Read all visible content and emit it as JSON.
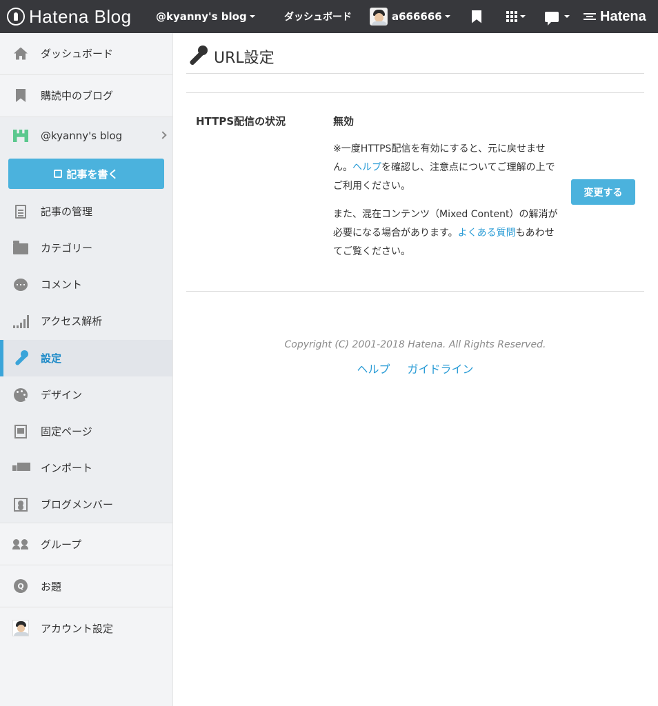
{
  "topbar": {
    "logo_text": "Hatena Blog",
    "blog_name": "@kyanny's blog",
    "dashboard_label": "ダッシュボード",
    "username": "a666666",
    "hatena_label": "Hatena"
  },
  "sidebar": {
    "items": [
      {
        "label": "ダッシュボード"
      },
      {
        "label": "購読中のブログ"
      },
      {
        "label": "@kyanny's blog"
      },
      {
        "label": "記事の管理"
      },
      {
        "label": "カテゴリー"
      },
      {
        "label": "コメント"
      },
      {
        "label": "アクセス解析"
      },
      {
        "label": "設定"
      },
      {
        "label": "デザイン"
      },
      {
        "label": "固定ページ"
      },
      {
        "label": "インポート"
      },
      {
        "label": "ブログメンバー"
      },
      {
        "label": "グループ"
      },
      {
        "label": "お題"
      },
      {
        "label": "アカウント設定"
      }
    ],
    "write_button": "記事を書く",
    "active_index": 7
  },
  "main": {
    "title": "URL設定",
    "https_label": "HTTPS配信の状況",
    "https_value": "無効",
    "desc1": {
      "part1": "※一度HTTPS配信を有効にすると、元に戻せません。",
      "link": "ヘルプ",
      "part2": "を確認し、注意点についてご理解の上でご利用ください。"
    },
    "desc2": {
      "part1": "また、混在コンテンツ（Mixed Content）の解消が必要になる場合があります。",
      "link": "よくある質問",
      "part2": "もあわせてご覧ください。"
    },
    "change_button": "変更する"
  },
  "footer": {
    "copyright": "Copyright (C) 2001-2018 Hatena. All Rights Reserved.",
    "links": [
      "ヘルプ",
      "ガイドライン"
    ]
  },
  "colors": {
    "topbar_bg": "#37383c",
    "accent": "#4bb2dd",
    "link": "#2a9cd6"
  }
}
